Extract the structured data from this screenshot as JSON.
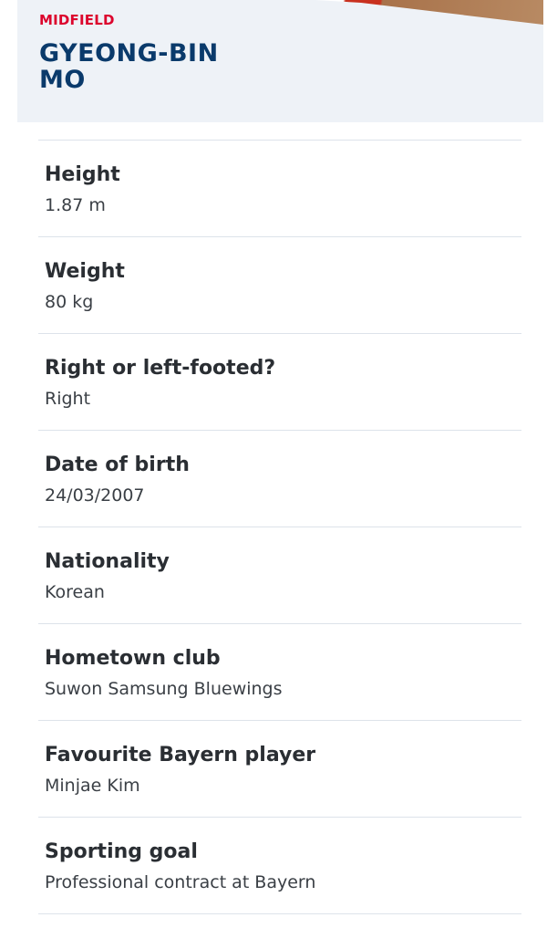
{
  "header": {
    "position": "MIDFIELD",
    "name": "GYEONG-BIN MO"
  },
  "details": [
    {
      "label": "Height",
      "value": "1.87 m"
    },
    {
      "label": "Weight",
      "value": "80 kg"
    },
    {
      "label": "Right or left-footed?",
      "value": "Right"
    },
    {
      "label": "Date of birth",
      "value": "24/03/2007"
    },
    {
      "label": "Nationality",
      "value": "Korean"
    },
    {
      "label": "Hometown club",
      "value": "Suwon Samsung Bluewings"
    },
    {
      "label": "Favourite Bayern player",
      "value": "Minjae Kim"
    },
    {
      "label": "Sporting goal",
      "value": "Professional contract at Bayern"
    }
  ],
  "colors": {
    "accent_red": "#dc052d",
    "name_blue": "#0a3a6b",
    "header_bg": "#eef2f7",
    "divider": "#dde3ea"
  }
}
